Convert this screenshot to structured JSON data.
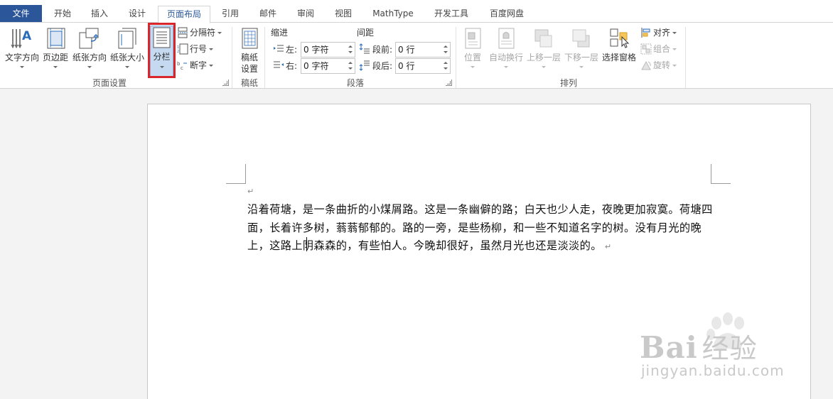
{
  "tabs": [
    {
      "label": "文件"
    },
    {
      "label": "开始"
    },
    {
      "label": "插入"
    },
    {
      "label": "设计"
    },
    {
      "label": "页面布局"
    },
    {
      "label": "引用"
    },
    {
      "label": "邮件"
    },
    {
      "label": "审阅"
    },
    {
      "label": "视图"
    },
    {
      "label": "MathType"
    },
    {
      "label": "开发工具"
    },
    {
      "label": "百度网盘"
    }
  ],
  "active_tab": "页面布局",
  "page_setup": {
    "group_label": "页面设置",
    "text_direction": "文字方向",
    "margins": "页边距",
    "orientation": "纸张方向",
    "size": "纸张大小",
    "columns": "分栏",
    "breaks": "分隔符",
    "line_numbers": "行号",
    "hyphenation": "断字"
  },
  "manuscript": {
    "group_label": "稿纸",
    "button_line1": "稿纸",
    "button_line2": "设置"
  },
  "paragraph": {
    "group_label": "段落",
    "indent_header": "缩进",
    "spacing_header": "间距",
    "left_label": "左:",
    "right_label": "右:",
    "before_label": "段前:",
    "after_label": "段后:",
    "left_value": "0 字符",
    "right_value": "0 字符",
    "before_value": "0 行",
    "after_value": "0 行"
  },
  "arrange": {
    "group_label": "排列",
    "position": "位置",
    "wrap_text": "自动换行",
    "bring_forward": "上移一层",
    "send_backward": "下移一层",
    "selection_pane": "选择窗格",
    "align": "对齐",
    "group": "组合",
    "rotate": "旋转"
  },
  "document": {
    "empty_mark": "↵",
    "body_text": "沿着荷塘，是一条曲折的小煤屑路。这是一条幽僻的路；白天也少人走，夜晚更加寂寞。荷塘四面，长着许多树，蓊蓊郁郁的。路的一旁，是些杨柳，和一些不知道名字的树。没有月光的晚上，这路上阴森森的，有些怕人。今晚却很好，虽然月光也还是淡淡的。",
    "end_mark": "↵"
  },
  "watermark": {
    "brand": "Bai",
    "brand_cn": "经验",
    "url": "jingyan.baidu.com"
  },
  "colors": {
    "file_tab": "#2b579a",
    "active_tab_text": "#2b579a",
    "highlight_box": "#d9262b",
    "selected_button": "#c5d9f1"
  }
}
